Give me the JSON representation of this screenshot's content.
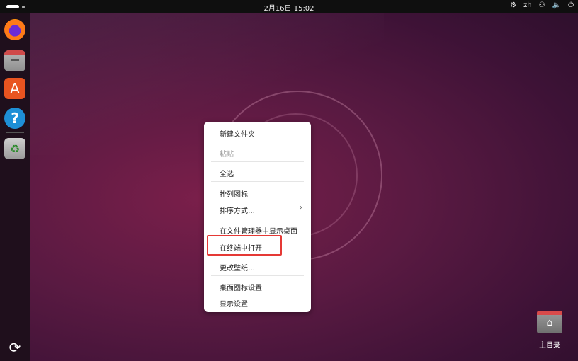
{
  "topbar": {
    "clock": "2月16日  15:02",
    "lang": "zh",
    "network_icon": "network-icon",
    "volume_icon": "volume-icon",
    "power_icon": "power-icon"
  },
  "dock": {
    "apps": [
      "firefox-icon",
      "files-icon",
      "app-center-icon",
      "help-icon",
      "trash-icon"
    ],
    "help_glyph": "?",
    "store_glyph": "A",
    "trash_glyph": "♻",
    "show_apps_glyph": "⟳"
  },
  "context_menu": {
    "items": [
      {
        "label": "新建文件夹",
        "enabled": true
      },
      {
        "label": "粘贴",
        "enabled": false
      },
      {
        "label": "全选",
        "enabled": true
      },
      {
        "label": "排列图标",
        "enabled": true
      },
      {
        "label": "排序方式…",
        "enabled": true
      },
      {
        "label": "在文件管理器中显示桌面",
        "enabled": true
      },
      {
        "label": "在终端中打开",
        "enabled": true
      },
      {
        "label": "更改壁纸…",
        "enabled": true
      },
      {
        "label": "桌面图标设置",
        "enabled": true
      },
      {
        "label": "显示设置",
        "enabled": true
      }
    ],
    "submenu_arrow": "›",
    "highlight_color": "#e53935"
  },
  "desktop": {
    "home_label": "主目录",
    "home_glyph": "⌂"
  },
  "colors": {
    "accent": "#e95420",
    "wallpaper": "#5a1a42"
  }
}
